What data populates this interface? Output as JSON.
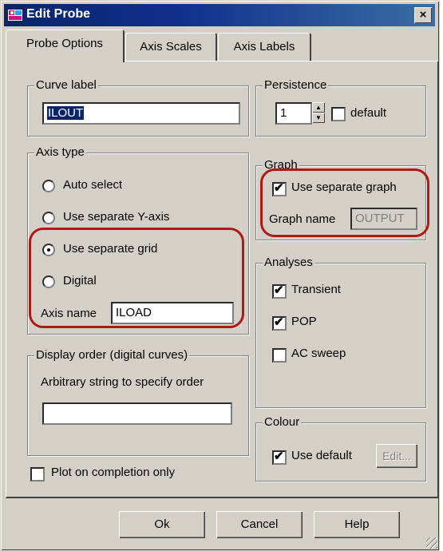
{
  "window": {
    "title": "Edit Probe",
    "close_label": "×"
  },
  "tabs": [
    {
      "label": "Probe Options"
    },
    {
      "label": "Axis Scales"
    },
    {
      "label": "Axis Labels"
    }
  ],
  "curve_label": {
    "legend": "Curve label",
    "value": "ILOUT"
  },
  "persistence": {
    "legend": "Persistence",
    "value": "1",
    "default_label": "default",
    "default_checked": false
  },
  "axis_type": {
    "legend": "Axis type",
    "options": [
      {
        "label": "Auto select",
        "checked": false
      },
      {
        "label": "Use separate Y-axis",
        "checked": false
      },
      {
        "label": "Use separate grid",
        "checked": true
      },
      {
        "label": "Digital",
        "checked": false
      }
    ],
    "axis_name_label": "Axis name",
    "axis_name_value": "ILOAD"
  },
  "graph": {
    "legend": "Graph",
    "use_separate_label": "Use separate graph",
    "use_separate_checked": true,
    "name_label": "Graph name",
    "name_value": "OUTPUT"
  },
  "analyses": {
    "legend": "Analyses",
    "items": [
      {
        "label": "Transient",
        "checked": true
      },
      {
        "label": "POP",
        "checked": true
      },
      {
        "label": "AC sweep",
        "checked": false
      }
    ]
  },
  "display_order": {
    "legend": "Display order (digital curves)",
    "description": "Arbitrary string to specify order",
    "value": ""
  },
  "colour": {
    "legend": "Colour",
    "use_default_label": "Use default",
    "use_default_checked": true,
    "edit_label": "Edit..."
  },
  "plot_on_completion": {
    "label": "Plot on completion only",
    "checked": false
  },
  "buttons": {
    "ok": "Ok",
    "cancel": "Cancel",
    "help": "Help"
  },
  "highlight_color": "#b01818"
}
